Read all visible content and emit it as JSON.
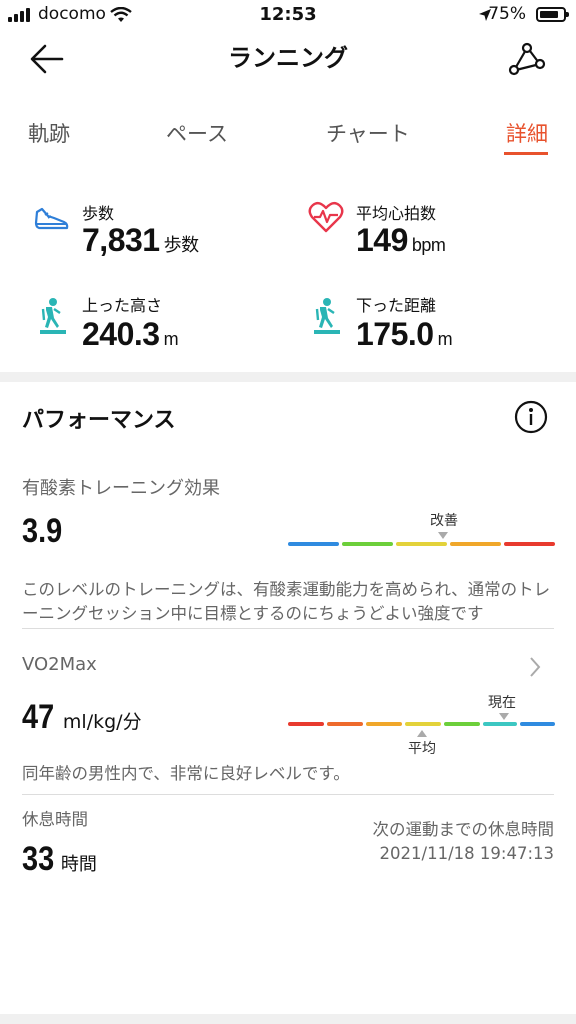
{
  "status": {
    "carrier": "docomo",
    "time": "12:53",
    "battery": "75%"
  },
  "header": {
    "title": "ランニング"
  },
  "tabs": [
    "軌跡",
    "ペース",
    "チャート",
    "詳細"
  ],
  "stats": [
    {
      "label": "歩数",
      "value": "7,831",
      "unit": "歩数",
      "icon": "shoe-icon"
    },
    {
      "label": "平均心拍数",
      "value": "149",
      "unit": "bpm",
      "icon": "heart-rate-icon"
    },
    {
      "label": "上った高さ",
      "value": "240.3",
      "unit": "m",
      "icon": "hiker-icon"
    },
    {
      "label": "下った距離",
      "value": "175.0",
      "unit": "m",
      "icon": "hiker-icon"
    }
  ],
  "performance": {
    "title": "パフォーマンス",
    "aerobic": {
      "label": "有酸素トレーニング効果",
      "value": "3.9",
      "marker_label": "改善",
      "description": "このレベルのトレーニングは、有酸素運動能力を高められ、通常のトレーニングセッション中に目標とするのにちょうどよい強度です"
    },
    "vo2max": {
      "label": "VO2Max",
      "value": "47",
      "unit": "ml/kg/分",
      "marker_current": "現在",
      "marker_average": "平均",
      "description": "同年齢の男性内で、非常に良好レベルです。"
    },
    "rest": {
      "label": "休息時間",
      "value": "33",
      "unit": "時間",
      "next_label": "次の運動までの休息時間",
      "next_time": "2021/11/18 19:47:13"
    }
  },
  "colors": {
    "accent": "#e8522d",
    "icon_blue": "#2f7fd8",
    "icon_red": "#e8364b",
    "icon_teal": "#2ab5b5"
  }
}
